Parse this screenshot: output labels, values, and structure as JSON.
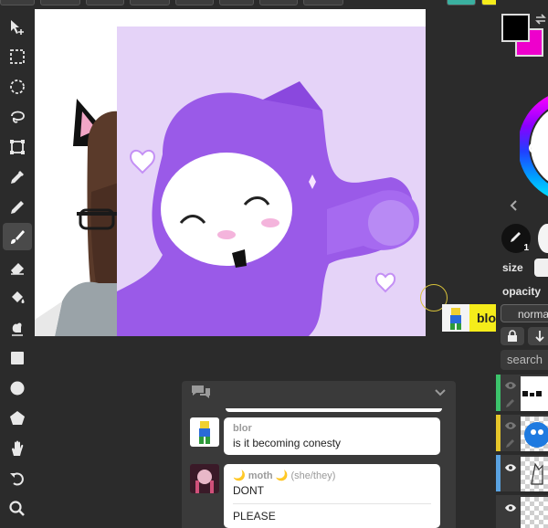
{
  "chat": {
    "messages": [
      {
        "user": "blor",
        "pronouns": "",
        "lines": [
          "is it becoming conesty"
        ]
      },
      {
        "user": "🌙 moth 🌙",
        "pronouns": "(she/they)",
        "lines": [
          "DONT",
          "PLEASE"
        ]
      }
    ]
  },
  "user_badge": {
    "name": "blor"
  },
  "right_panel": {
    "size_label": "size",
    "opacity_label": "opacity",
    "blend_mode": "norma",
    "search_placeholder": "search",
    "brush_count": "1"
  },
  "colors": {
    "foreground": "#000000",
    "background": "#ee00cc",
    "user_badge": "#f5ec1a",
    "layer_strips": [
      "#3cc36b",
      "#e6c62a",
      "#5aa2e0"
    ]
  },
  "toolbar": {
    "tools": [
      "move-tool-icon",
      "rect-select-icon",
      "ellipse-select-icon",
      "lasso-icon",
      "transform-icon",
      "eyedropper-icon",
      "pencil-icon",
      "brush-icon",
      "eraser-icon",
      "fill-bucket-icon",
      "smudge-icon",
      "rectangle-icon",
      "ellipse-icon",
      "polygon-icon",
      "hand-icon",
      "undo-icon",
      "zoom-icon"
    ],
    "active": "brush-icon"
  }
}
